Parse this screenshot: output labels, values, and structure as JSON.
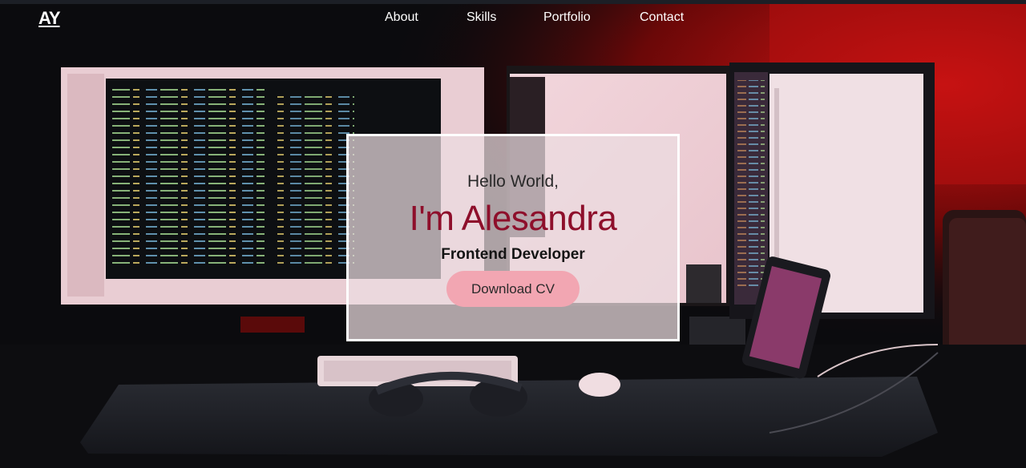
{
  "nav": {
    "logo": "AY",
    "links": [
      {
        "label": "About"
      },
      {
        "label": "Skills"
      },
      {
        "label": "Portfolio"
      },
      {
        "label": "Contact"
      }
    ]
  },
  "hero": {
    "greeting": "Hello World,",
    "name": "I'm Alesandra",
    "role": "Frontend Developer",
    "cta_label": "Download CV"
  },
  "colors": {
    "name_accent": "#8e0f2b",
    "button_bg": "#f2a6b2",
    "card_border": "#ffffff",
    "background_glow": "#c41010"
  },
  "background": {
    "icons": [
      "monitor-icon",
      "keyboard-icon",
      "mouse-icon",
      "headphones-icon",
      "phone-icon",
      "desktop-tower-icon"
    ]
  }
}
